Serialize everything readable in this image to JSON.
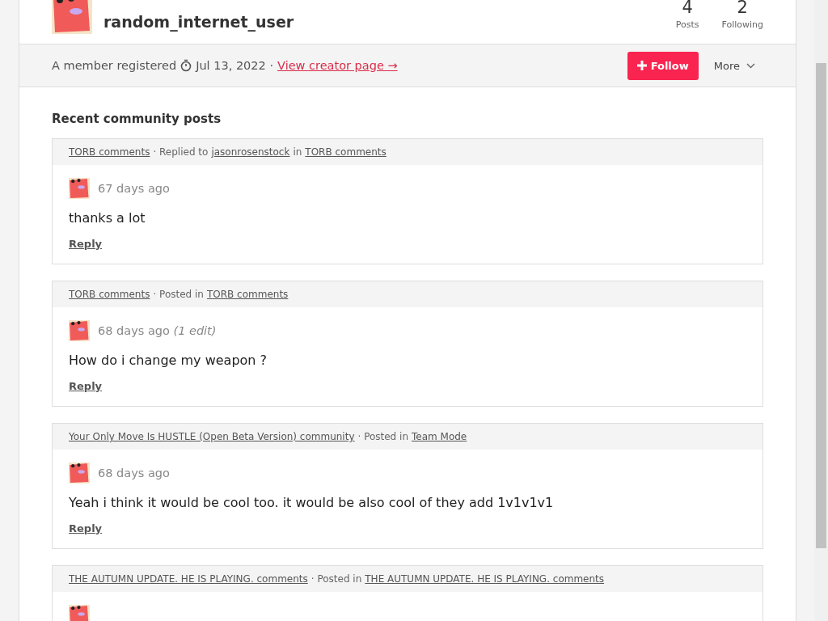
{
  "profile": {
    "username": "random_internet_user",
    "stats": [
      {
        "value": "4",
        "label": "Posts"
      },
      {
        "value": "2",
        "label": "Following"
      }
    ]
  },
  "member_bar": {
    "registered_text": "A member registered",
    "date": "Jul 13, 2022 ·",
    "creator_link": "View creator page →",
    "follow_button": "Follow",
    "more_button": "More"
  },
  "section_title": "Recent community posts",
  "posts": [
    {
      "breadcrumb": [
        {
          "kind": "link",
          "text": "TORB comments"
        },
        {
          "kind": "text",
          "text": "· Replied to"
        },
        {
          "kind": "link",
          "text": "jasonrosenstock"
        },
        {
          "kind": "text",
          "text": "in"
        },
        {
          "kind": "link",
          "text": "TORB comments"
        }
      ],
      "time": "67 days ago",
      "body": "thanks a lot",
      "reply": "Reply"
    },
    {
      "breadcrumb": [
        {
          "kind": "link",
          "text": "TORB comments"
        },
        {
          "kind": "text",
          "text": "· Posted in"
        },
        {
          "kind": "link",
          "text": "TORB comments"
        }
      ],
      "time": "68 days ago",
      "edit_note": "(1 edit)",
      "body": "How do i change my weapon ?",
      "reply": "Reply"
    },
    {
      "breadcrumb": [
        {
          "kind": "link",
          "text": "Your Only Move Is HUSTLE (Open Beta Version) community"
        },
        {
          "kind": "text",
          "text": "· Posted in"
        },
        {
          "kind": "link",
          "text": "Team Mode"
        }
      ],
      "time": "68 days ago",
      "body": "Yeah i think it would be cool too. it would be also cool of they add 1v1v1v1",
      "reply": "Reply"
    },
    {
      "breadcrumb": [
        {
          "kind": "link",
          "text": "THE AUTUMN UPDATE. HE IS PLAYING. comments"
        },
        {
          "kind": "text",
          "text": "· Posted in"
        },
        {
          "kind": "link",
          "text": "THE AUTUMN UPDATE. HE IS PLAYING. comments"
        }
      ]
    }
  ]
}
